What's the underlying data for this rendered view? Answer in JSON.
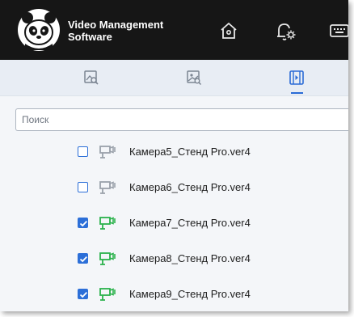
{
  "app": {
    "title_line1": "Video Management",
    "title_line2": "Software"
  },
  "header_icons": [
    "home-icon",
    "bell-settings-icon",
    "keyboard-icon"
  ],
  "tabs": [
    {
      "name": "image-search-tab",
      "active": false
    },
    {
      "name": "image-gallery-tab",
      "active": false
    },
    {
      "name": "video-tab",
      "active": true
    }
  ],
  "search": {
    "placeholder": "Поиск",
    "value": ""
  },
  "cameras": [
    {
      "label": "Камера5_Стенд Pro.ver4",
      "checked": false,
      "online": false
    },
    {
      "label": "Камера6_Стенд Pro.ver4",
      "checked": false,
      "online": false
    },
    {
      "label": "Камера7_Стенд Pro.ver4",
      "checked": true,
      "online": true
    },
    {
      "label": "Камера8_Стенд Pro.ver4",
      "checked": true,
      "online": true
    },
    {
      "label": "Камера9_Стенд Pro.ver4",
      "checked": true,
      "online": true
    }
  ],
  "colors": {
    "header_bg": "#161616",
    "accent": "#2c6fd8",
    "camera_online": "#2bb24c",
    "camera_offline": "#9aa1aa"
  }
}
